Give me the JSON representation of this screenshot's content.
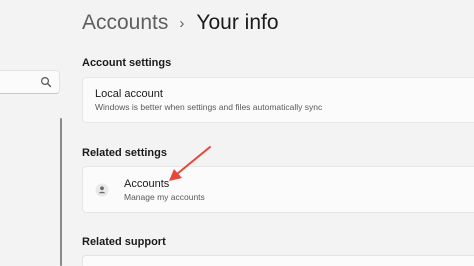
{
  "header": {
    "parent": "Accounts",
    "separator": "›",
    "current": "Your info"
  },
  "nav": {
    "search_icon": "search-icon"
  },
  "sections": {
    "account_settings": {
      "title": "Account settings",
      "local_account": {
        "title": "Local account",
        "subtitle": "Windows is better when settings and files automatically sync"
      }
    },
    "related_settings": {
      "title": "Related settings",
      "accounts": {
        "icon": "person-icon",
        "title": "Accounts",
        "subtitle": "Manage my accounts"
      }
    },
    "related_support": {
      "title": "Related support"
    }
  },
  "colors": {
    "background": "#f3f3f3",
    "card": "#fbfbfb",
    "annotation_arrow": "#e5483b"
  }
}
